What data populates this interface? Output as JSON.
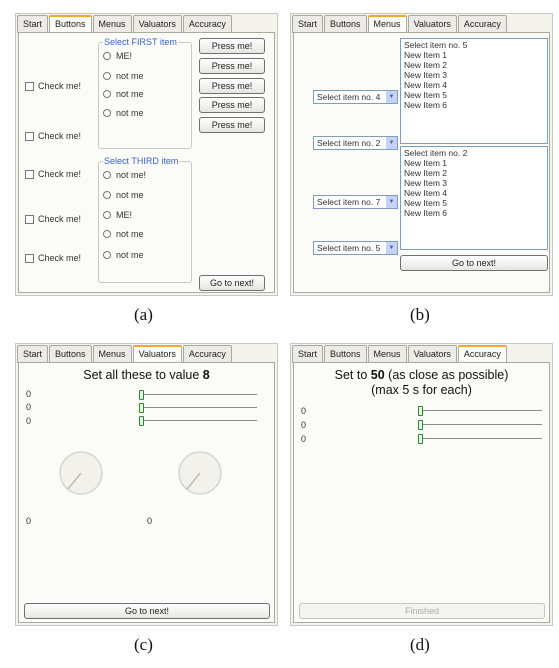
{
  "captions": [
    "(a)",
    "(b)",
    "(c)",
    "(d)"
  ],
  "tabs": [
    "Start",
    "Buttons",
    "Menus",
    "Valuators",
    "Accuracy"
  ],
  "panel_a": {
    "active_tab": "Buttons",
    "checkboxes": [
      "Check me!",
      "Check me!",
      "Check me!",
      "Check me!",
      "Check me!"
    ],
    "group1": {
      "legend": "Select FIRST item",
      "options": [
        "ME!",
        "not me",
        "not me",
        "not me"
      ]
    },
    "group2": {
      "legend": "Select THIRD item",
      "options": [
        "not me!",
        "not me",
        "ME!",
        "not me",
        "not me"
      ]
    },
    "press_buttons": [
      "Press me!",
      "Press me!",
      "Press me!",
      "Press me!",
      "Press me!"
    ],
    "next_button": "Go to next!"
  },
  "panel_b": {
    "active_tab": "Menus",
    "selects": [
      "Select item no. 4",
      "Select item no. 2",
      "Select item no. 7",
      "Select item no. 5"
    ],
    "list1": [
      "Select item no. 5",
      "New Item 1",
      "New Item 2",
      "New Item 3",
      "New Item 4",
      "New Item 5",
      "New Item 6"
    ],
    "list2": [
      "Select item no. 2",
      "New Item 1",
      "New Item 2",
      "New Item 3",
      "New Item 4",
      "New Item 5",
      "New Item 6"
    ],
    "next_button": "Go to next!"
  },
  "panel_c": {
    "active_tab": "Valuators",
    "title_prefix": "Set all these to value ",
    "title_value": "8",
    "slider_values": [
      "0",
      "0",
      "0"
    ],
    "knob_values": [
      "0",
      "0"
    ],
    "next_button": "Go to next!"
  },
  "panel_d": {
    "active_tab": "Accuracy",
    "title_prefix": "Set to ",
    "title_value": "50",
    "title_suffix": " (as close as possible)",
    "title_line2": "(max 5 s for each)",
    "slider_values": [
      "0",
      "0",
      "0"
    ],
    "finish_button": "Finished"
  },
  "colors": {
    "active_tab_accent": "#f0a830",
    "legend_blue": "#3a63c9",
    "slider_thumb": "#2a8a2a"
  },
  "icons": [
    "dropdown-arrow-icon",
    "checkbox-icon",
    "radio-icon",
    "knob-dial-icon",
    "slider-thumb-icon"
  ]
}
